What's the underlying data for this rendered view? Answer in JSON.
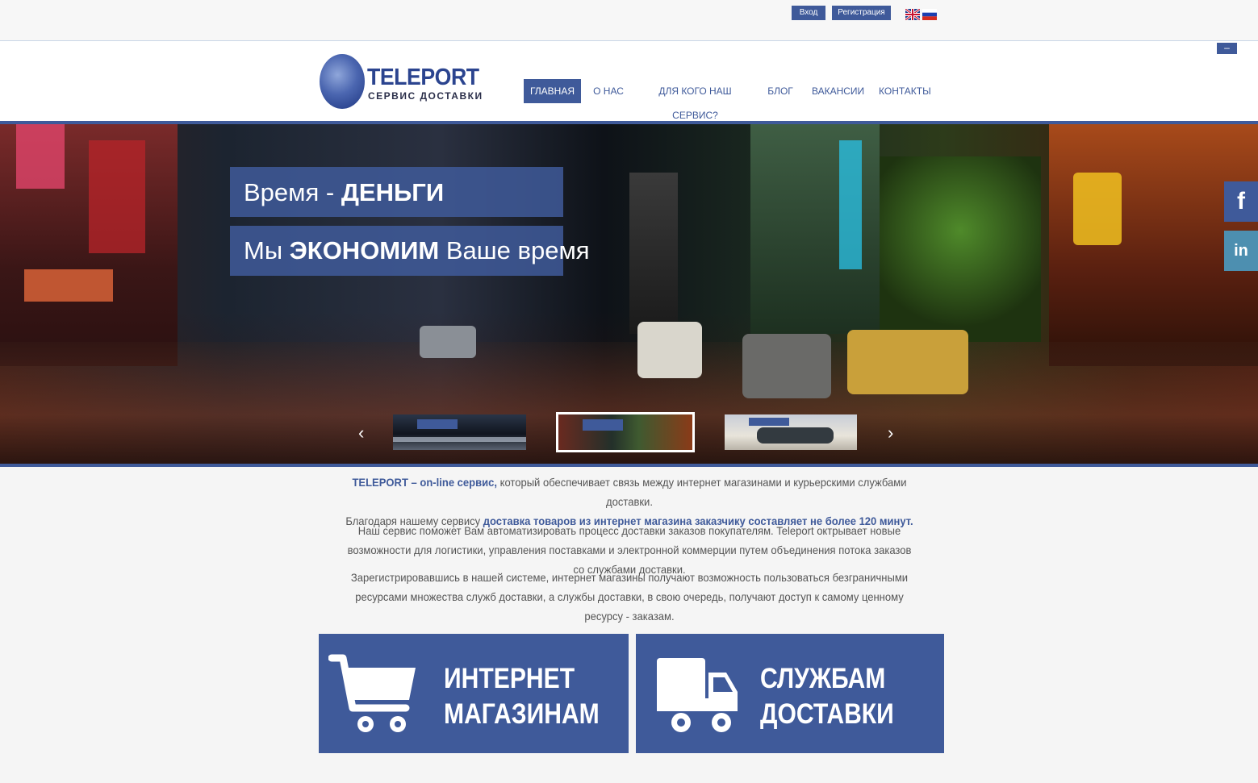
{
  "topbar": {
    "login_label": "Вход",
    "register_label": "Регистрация",
    "languages": [
      "en-flag",
      "ru-flag"
    ]
  },
  "header": {
    "collapse_label": "–",
    "logo_title": "TELEPORT",
    "logo_subtitle": "СЕРВИС ДОСТАВКИ",
    "nav": [
      {
        "label": "ГЛАВНАЯ",
        "active": true
      },
      {
        "label": "О НАС"
      },
      {
        "label": "ДЛЯ КОГО НАШ СЕРВИС?"
      },
      {
        "label": "БЛОГ"
      },
      {
        "label": "ВАКАНСИИ"
      },
      {
        "label": "КОНТАКТЫ"
      }
    ]
  },
  "hero": {
    "line1_normal": "Время - ",
    "line1_bold": "ДЕНЬГИ",
    "line2_a": "Мы ",
    "line2_bold": "ЭКОНОМИМ",
    "line2_b": " Ваше время",
    "prev_icon": "chevron-left-icon",
    "next_icon": "chevron-right-icon",
    "thumbnails": [
      "slide-1",
      "slide-2",
      "slide-3"
    ],
    "active_thumbnail": 1
  },
  "social": {
    "facebook": "f",
    "linkedin": "in"
  },
  "content": {
    "p1_hl": "TELEPORT – on-line сервис,",
    "p1_rest": " который обеспечивает связь между интернет магазинами и курьерскими службами доставки.",
    "p1b_text": "Благодаря нашему сервису ",
    "p1b_hl": "доставка товаров из интернет магазина заказчику составляет не более 120 минут.",
    "p2": "Наш сервис поможет Вам автоматизировать процесс доставки заказов покупателям. Teleport октрывает новые возможности для логистики, управления поставками и электронной коммерции путем объединения потока заказов со службами доставки.",
    "p3": "Зарегистрировавшись в нашей системе, интернет магазины получают возможность пользоваться безграничными ресурсами множества  служб доставки, а службы доставки, в свою очередь, получают доступ к самому ценному ресурсу - заказам."
  },
  "cards": [
    {
      "line1": "ИНТЕРНЕТ",
      "line2": "МАГАЗИНАМ",
      "icon": "cart-icon"
    },
    {
      "line1": "СЛУЖБАМ",
      "line2": "ДОСТАВКИ",
      "icon": "truck-icon"
    }
  ],
  "colors": {
    "brand": "#3f5a9a",
    "text": "#555555"
  }
}
